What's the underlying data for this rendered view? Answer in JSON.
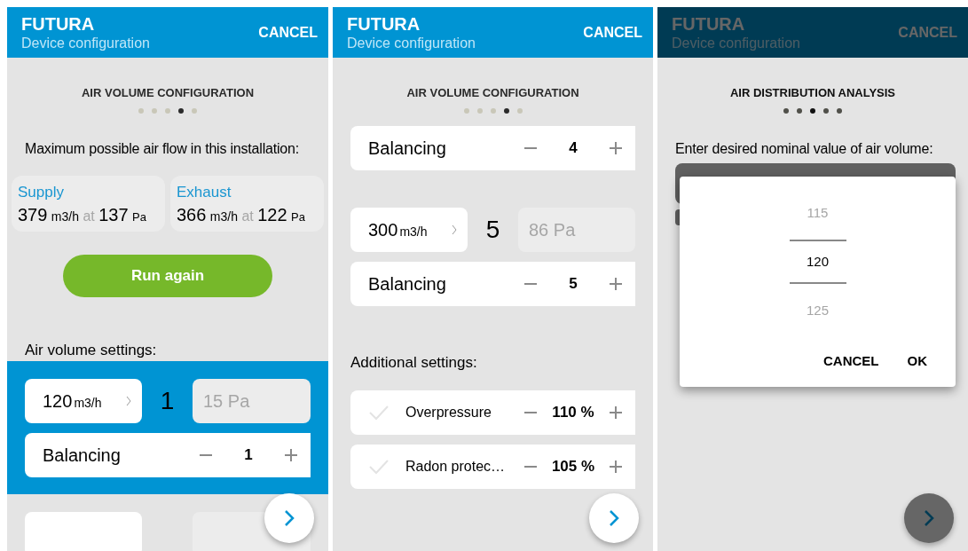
{
  "screens": [
    {
      "header": {
        "title": "FUTURA",
        "subtitle": "Device configuration",
        "action": "CANCEL"
      },
      "dimmed": false,
      "step_title": "AIR VOLUME CONFIGURATION",
      "steps": [
        {
          "selected": false
        },
        {
          "selected": false
        },
        {
          "selected": false
        },
        {
          "selected": true
        },
        {
          "selected": false
        }
      ],
      "content": [
        {
          "kind": "paragraph",
          "text": "Maximum possible air flow in this installation:"
        },
        {
          "kind": "cards",
          "cards": [
            {
              "title": "Supply",
              "flow": "379",
              "flow_unit": "m3/h",
              "at": "at",
              "pressure": "137",
              "pressure_unit": "Pa"
            },
            {
              "title": "Exhaust",
              "flow": "366",
              "flow_unit": "m3/h",
              "at": "at",
              "pressure": "122",
              "pressure_unit": "Pa"
            }
          ]
        },
        {
          "kind": "pill",
          "label": "Run again"
        },
        {
          "kind": "label",
          "text": "Air volume settings:"
        },
        {
          "kind": "point",
          "volume": "120",
          "unit": "m3/h",
          "number": "1",
          "pressure": "15 Pa",
          "selected": true,
          "balancing": {
            "label": "Balancing",
            "value": "1"
          }
        },
        {
          "kind": "cut_row"
        }
      ]
    },
    {
      "header": {
        "title": "FUTURA",
        "subtitle": "Device configuration",
        "action": "CANCEL"
      },
      "dimmed": false,
      "step_title": "AIR VOLUME CONFIGURATION",
      "steps": [
        {
          "selected": false
        },
        {
          "selected": false
        },
        {
          "selected": false
        },
        {
          "selected": true
        },
        {
          "selected": false
        }
      ],
      "content": [
        {
          "kind": "balancing",
          "label": "Balancing",
          "value": "4"
        },
        {
          "kind": "point",
          "volume": "300",
          "unit": "m3/h",
          "number": "5",
          "pressure": "86 Pa",
          "selected": false,
          "balancing": {
            "label": "Balancing",
            "value": "5"
          }
        },
        {
          "kind": "label",
          "text": "Additional settings:"
        },
        {
          "kind": "option",
          "label": "Overpressure",
          "value": "110 %",
          "checked": false
        },
        {
          "kind": "option",
          "label": "Radon protec…",
          "value": "105 %",
          "checked": false
        }
      ]
    },
    {
      "header": {
        "title": "FUTURA",
        "subtitle": "Device configuration",
        "action": "CANCEL"
      },
      "dimmed": true,
      "step_title": "AIR DISTRIBUTION ANALYSIS",
      "steps": [
        {
          "selected": false
        },
        {
          "selected": false
        },
        {
          "selected": true
        },
        {
          "selected": false
        },
        {
          "selected": false
        }
      ],
      "content": [
        {
          "kind": "paragraph",
          "text": "Enter desired nominal value of air volume:"
        },
        {
          "kind": "field"
        },
        {
          "kind": "small_field"
        }
      ],
      "dialog": {
        "values": [
          {
            "text": "115",
            "selected": false
          },
          {
            "text": "120",
            "selected": true
          },
          {
            "text": "125",
            "selected": false
          }
        ],
        "buttons": [
          "CANCEL",
          "OK"
        ]
      }
    }
  ]
}
